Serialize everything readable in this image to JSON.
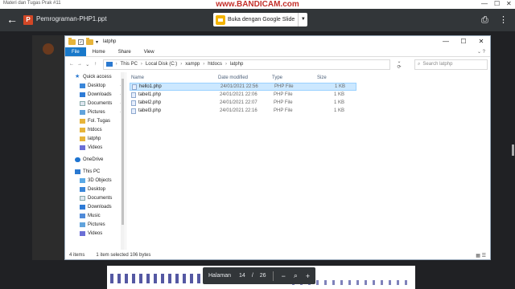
{
  "topstrip": {
    "tab_title": "Materi dan Tugas Prak #11",
    "watermark": "www.BANDICAM.com",
    "ctl_min": "—",
    "ctl_max": "☐",
    "ctl_close": "✕"
  },
  "viewer": {
    "back_icon": "arrow-left-icon",
    "file_name": "Pemrograman-PHP1.ppt",
    "open_with_label": "Buka dengan Google Slide",
    "dropdown_glyph": "▼",
    "print_glyph": "⎙",
    "more_glyph": "⋮"
  },
  "explorer": {
    "title": "latphp",
    "ribbon_tabs": [
      "File",
      "Home",
      "Share",
      "View"
    ],
    "ribbon_expand": "⌄ ?",
    "nav_glyphs": {
      "back": "←",
      "forward": "→",
      "down": "⌄",
      "up": "↑"
    },
    "path": [
      "This PC",
      "Local Disk (C:)",
      "xampp",
      "htdocs",
      "latphp"
    ],
    "search_placeholder": "Search latphp",
    "sidebar": [
      {
        "label": "Quick access",
        "icon": "star-icon",
        "kind": "star"
      },
      {
        "label": "Desktop",
        "icon": "desktop-icon",
        "kind": "blue",
        "pinned": true
      },
      {
        "label": "Downloads",
        "icon": "download-icon",
        "kind": "dl",
        "pinned": true
      },
      {
        "label": "Documents",
        "icon": "documents-icon",
        "kind": "doc",
        "pinned": true
      },
      {
        "label": "Pictures",
        "icon": "pictures-icon",
        "kind": "pic",
        "pinned": true
      },
      {
        "label": "Fol. Tugas",
        "icon": "folder-icon",
        "kind": "yel"
      },
      {
        "label": "htdocs",
        "icon": "folder-icon",
        "kind": "yel"
      },
      {
        "label": "latphp",
        "icon": "folder-icon",
        "kind": "yel"
      },
      {
        "label": "Videos",
        "icon": "videos-icon",
        "kind": "vid"
      },
      {
        "label": "",
        "icon": "",
        "kind": "gap"
      },
      {
        "label": "OneDrive",
        "icon": "onedrive-icon",
        "kind": "od"
      },
      {
        "label": "",
        "icon": "",
        "kind": "gap"
      },
      {
        "label": "This PC",
        "icon": "computer-icon",
        "kind": "pc"
      },
      {
        "label": "3D Objects",
        "icon": "3d-objects-icon",
        "kind": "obj"
      },
      {
        "label": "Desktop",
        "icon": "desktop-icon",
        "kind": "blue"
      },
      {
        "label": "Documents",
        "icon": "documents-icon",
        "kind": "doc"
      },
      {
        "label": "Downloads",
        "icon": "download-icon",
        "kind": "dl"
      },
      {
        "label": "Music",
        "icon": "music-icon",
        "kind": "mus"
      },
      {
        "label": "Pictures",
        "icon": "pictures-icon",
        "kind": "pic"
      },
      {
        "label": "Videos",
        "icon": "videos-icon",
        "kind": "vid"
      }
    ],
    "columns": {
      "name": "Name",
      "date": "Date modified",
      "type": "Type",
      "size": "Size"
    },
    "files": [
      {
        "name": "hello1.php",
        "date": "24/01/2021 22:56",
        "type": "PHP File",
        "size": "1 KB",
        "selected": true
      },
      {
        "name": "tabel1.php",
        "date": "24/01/2021 22:06",
        "type": "PHP File",
        "size": "1 KB",
        "selected": false
      },
      {
        "name": "tabel2.php",
        "date": "24/01/2021 22:07",
        "type": "PHP File",
        "size": "1 KB",
        "selected": false
      },
      {
        "name": "tabel3.php",
        "date": "24/01/2021 22:16",
        "type": "PHP File",
        "size": "1 KB",
        "selected": false
      }
    ],
    "status": {
      "count": "4 items",
      "selection": "1 item selected  106 bytes",
      "views": "▦ ☰"
    }
  },
  "pagebar": {
    "label": "Halaman",
    "current": "14",
    "slash": "/",
    "total": "26",
    "zoom_out": "−",
    "zoom_icon": "⌕",
    "zoom_in": "+"
  }
}
